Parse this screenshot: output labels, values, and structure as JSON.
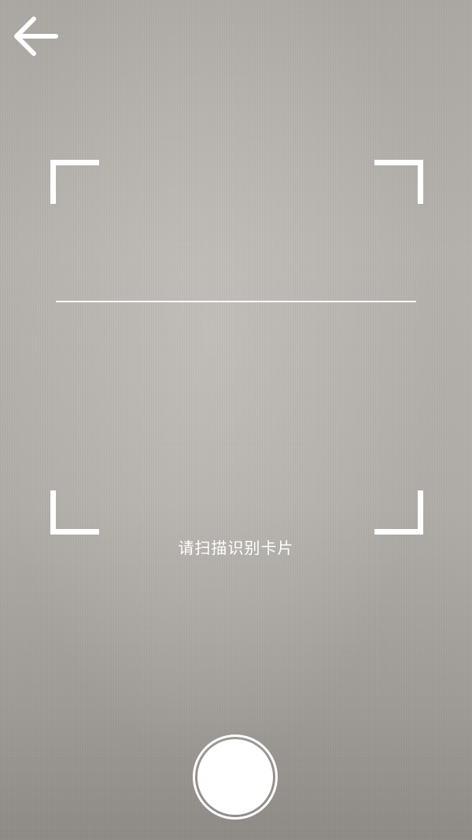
{
  "header": {
    "back_icon": "arrow-left-icon"
  },
  "scanner": {
    "hint": "请扫描识别卡片"
  },
  "footer": {
    "shutter_icon": "circle-shutter-icon"
  },
  "colors": {
    "frame": "#ffffff",
    "text": "#ffffff"
  }
}
